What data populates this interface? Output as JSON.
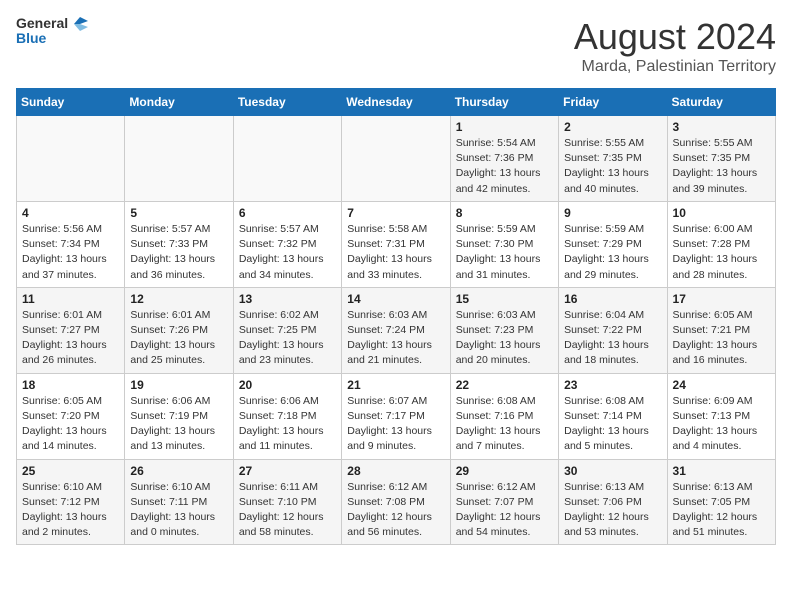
{
  "header": {
    "logo_line1": "General",
    "logo_line2": "Blue",
    "main_title": "August 2024",
    "sub_title": "Marda, Palestinian Territory"
  },
  "days_of_week": [
    "Sunday",
    "Monday",
    "Tuesday",
    "Wednesday",
    "Thursday",
    "Friday",
    "Saturday"
  ],
  "weeks": [
    [
      {
        "day": "",
        "info": ""
      },
      {
        "day": "",
        "info": ""
      },
      {
        "day": "",
        "info": ""
      },
      {
        "day": "",
        "info": ""
      },
      {
        "day": "1",
        "info": "Sunrise: 5:54 AM\nSunset: 7:36 PM\nDaylight: 13 hours\nand 42 minutes."
      },
      {
        "day": "2",
        "info": "Sunrise: 5:55 AM\nSunset: 7:35 PM\nDaylight: 13 hours\nand 40 minutes."
      },
      {
        "day": "3",
        "info": "Sunrise: 5:55 AM\nSunset: 7:35 PM\nDaylight: 13 hours\nand 39 minutes."
      }
    ],
    [
      {
        "day": "4",
        "info": "Sunrise: 5:56 AM\nSunset: 7:34 PM\nDaylight: 13 hours\nand 37 minutes."
      },
      {
        "day": "5",
        "info": "Sunrise: 5:57 AM\nSunset: 7:33 PM\nDaylight: 13 hours\nand 36 minutes."
      },
      {
        "day": "6",
        "info": "Sunrise: 5:57 AM\nSunset: 7:32 PM\nDaylight: 13 hours\nand 34 minutes."
      },
      {
        "day": "7",
        "info": "Sunrise: 5:58 AM\nSunset: 7:31 PM\nDaylight: 13 hours\nand 33 minutes."
      },
      {
        "day": "8",
        "info": "Sunrise: 5:59 AM\nSunset: 7:30 PM\nDaylight: 13 hours\nand 31 minutes."
      },
      {
        "day": "9",
        "info": "Sunrise: 5:59 AM\nSunset: 7:29 PM\nDaylight: 13 hours\nand 29 minutes."
      },
      {
        "day": "10",
        "info": "Sunrise: 6:00 AM\nSunset: 7:28 PM\nDaylight: 13 hours\nand 28 minutes."
      }
    ],
    [
      {
        "day": "11",
        "info": "Sunrise: 6:01 AM\nSunset: 7:27 PM\nDaylight: 13 hours\nand 26 minutes."
      },
      {
        "day": "12",
        "info": "Sunrise: 6:01 AM\nSunset: 7:26 PM\nDaylight: 13 hours\nand 25 minutes."
      },
      {
        "day": "13",
        "info": "Sunrise: 6:02 AM\nSunset: 7:25 PM\nDaylight: 13 hours\nand 23 minutes."
      },
      {
        "day": "14",
        "info": "Sunrise: 6:03 AM\nSunset: 7:24 PM\nDaylight: 13 hours\nand 21 minutes."
      },
      {
        "day": "15",
        "info": "Sunrise: 6:03 AM\nSunset: 7:23 PM\nDaylight: 13 hours\nand 20 minutes."
      },
      {
        "day": "16",
        "info": "Sunrise: 6:04 AM\nSunset: 7:22 PM\nDaylight: 13 hours\nand 18 minutes."
      },
      {
        "day": "17",
        "info": "Sunrise: 6:05 AM\nSunset: 7:21 PM\nDaylight: 13 hours\nand 16 minutes."
      }
    ],
    [
      {
        "day": "18",
        "info": "Sunrise: 6:05 AM\nSunset: 7:20 PM\nDaylight: 13 hours\nand 14 minutes."
      },
      {
        "day": "19",
        "info": "Sunrise: 6:06 AM\nSunset: 7:19 PM\nDaylight: 13 hours\nand 13 minutes."
      },
      {
        "day": "20",
        "info": "Sunrise: 6:06 AM\nSunset: 7:18 PM\nDaylight: 13 hours\nand 11 minutes."
      },
      {
        "day": "21",
        "info": "Sunrise: 6:07 AM\nSunset: 7:17 PM\nDaylight: 13 hours\nand 9 minutes."
      },
      {
        "day": "22",
        "info": "Sunrise: 6:08 AM\nSunset: 7:16 PM\nDaylight: 13 hours\nand 7 minutes."
      },
      {
        "day": "23",
        "info": "Sunrise: 6:08 AM\nSunset: 7:14 PM\nDaylight: 13 hours\nand 5 minutes."
      },
      {
        "day": "24",
        "info": "Sunrise: 6:09 AM\nSunset: 7:13 PM\nDaylight: 13 hours\nand 4 minutes."
      }
    ],
    [
      {
        "day": "25",
        "info": "Sunrise: 6:10 AM\nSunset: 7:12 PM\nDaylight: 13 hours\nand 2 minutes."
      },
      {
        "day": "26",
        "info": "Sunrise: 6:10 AM\nSunset: 7:11 PM\nDaylight: 13 hours\nand 0 minutes."
      },
      {
        "day": "27",
        "info": "Sunrise: 6:11 AM\nSunset: 7:10 PM\nDaylight: 12 hours\nand 58 minutes."
      },
      {
        "day": "28",
        "info": "Sunrise: 6:12 AM\nSunset: 7:08 PM\nDaylight: 12 hours\nand 56 minutes."
      },
      {
        "day": "29",
        "info": "Sunrise: 6:12 AM\nSunset: 7:07 PM\nDaylight: 12 hours\nand 54 minutes."
      },
      {
        "day": "30",
        "info": "Sunrise: 6:13 AM\nSunset: 7:06 PM\nDaylight: 12 hours\nand 53 minutes."
      },
      {
        "day": "31",
        "info": "Sunrise: 6:13 AM\nSunset: 7:05 PM\nDaylight: 12 hours\nand 51 minutes."
      }
    ]
  ]
}
